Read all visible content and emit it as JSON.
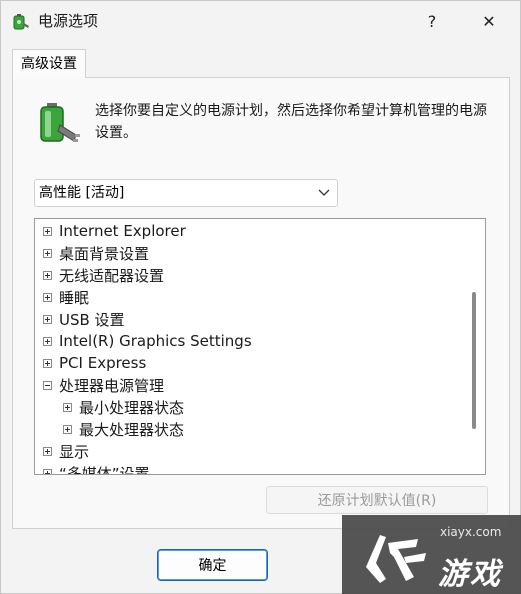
{
  "window": {
    "title": "电源选项",
    "help_label": "?",
    "close_label": "✕"
  },
  "tabs": [
    {
      "label": "高级设置"
    }
  ],
  "description": "选择你要自定义的电源计划，然后选择你希望计算机管理的电源设置。",
  "plan_select": {
    "value": "高性能 [活动]"
  },
  "tree": {
    "items": [
      {
        "label": "Internet Explorer",
        "expander": "plus"
      },
      {
        "label": "桌面背景设置",
        "expander": "plus"
      },
      {
        "label": "无线适配器设置",
        "expander": "plus"
      },
      {
        "label": "睡眠",
        "expander": "plus"
      },
      {
        "label": "USB 设置",
        "expander": "plus"
      },
      {
        "label": "Intel(R) Graphics Settings",
        "expander": "plus"
      },
      {
        "label": "PCI Express",
        "expander": "plus"
      },
      {
        "label": "处理器电源管理",
        "expander": "minus"
      },
      {
        "label": "最小处理器状态",
        "expander": "plus"
      },
      {
        "label": "最大处理器状态",
        "expander": "plus"
      },
      {
        "label": "显示",
        "expander": "plus"
      },
      {
        "label": "“多媒体”设置",
        "expander": "plus"
      }
    ]
  },
  "buttons": {
    "restore_defaults": "还原计划默认值(R)",
    "ok": "确定"
  },
  "watermark": {
    "url": "xiayx.com",
    "name": "游戏"
  },
  "icons": {
    "app": "power-plug-icon",
    "battery": "battery-plug-icon",
    "chevron": "chevron-down-icon"
  },
  "colors": {
    "accent": "#1a66b5",
    "battery_green": "#3aa53a"
  }
}
